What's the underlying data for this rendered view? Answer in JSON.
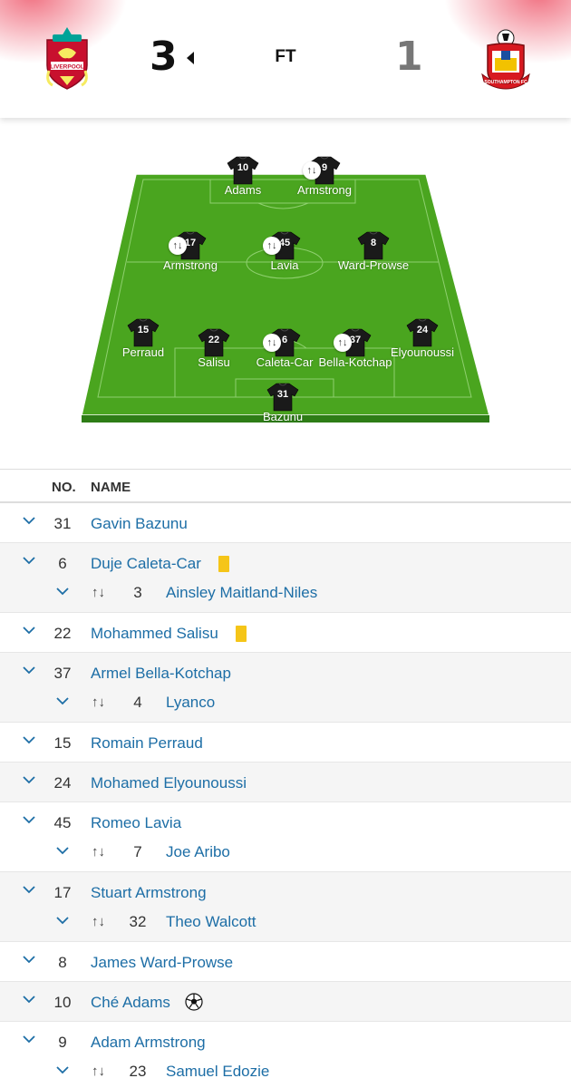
{
  "match": {
    "home_score": "3",
    "away_score": "1",
    "status": "FT",
    "home_crest": "liverpool-crest",
    "away_crest": "southampton-crest",
    "home_crest_text": "LIVERPOOL",
    "away_crest_text": "SOUTHAMPTON FC"
  },
  "colors": {
    "pitch": "#4aa51f",
    "pitch_edge": "#2e7d16",
    "link": "#1d6ea6",
    "yellow_card": "#f5c518",
    "shirt": "#1a1a1a"
  },
  "pitch": {
    "players": [
      {
        "num": "10",
        "name": "Adams",
        "sub": false
      },
      {
        "num": "9",
        "name": "Armstrong",
        "sub": true
      },
      {
        "num": "17",
        "name": "Armstrong",
        "sub": true
      },
      {
        "num": "45",
        "name": "Lavia",
        "sub": true
      },
      {
        "num": "8",
        "name": "Ward-Prowse",
        "sub": false
      },
      {
        "num": "15",
        "name": "Perraud",
        "sub": false
      },
      {
        "num": "22",
        "name": "Salisu",
        "sub": false
      },
      {
        "num": "6",
        "name": "Caleta-Car",
        "sub": true
      },
      {
        "num": "37",
        "name": "Bella-Kotchap",
        "sub": true
      },
      {
        "num": "24",
        "name": "Elyounoussi",
        "sub": false
      },
      {
        "num": "31",
        "name": "Bazunu",
        "sub": false
      }
    ]
  },
  "table": {
    "col_no": "NO.",
    "col_name": "NAME",
    "sub_arrows_glyph": "↑↓",
    "rows": [
      {
        "num": "31",
        "name": "Gavin Bazunu"
      },
      {
        "num": "6",
        "name": "Duje Caleta-Car",
        "card": "yellow",
        "sub_num": "3",
        "sub_name": "Ainsley Maitland-Niles"
      },
      {
        "num": "22",
        "name": "Mohammed Salisu",
        "card": "yellow"
      },
      {
        "num": "37",
        "name": "Armel Bella-Kotchap",
        "sub_num": "4",
        "sub_name": "Lyanco"
      },
      {
        "num": "15",
        "name": "Romain Perraud"
      },
      {
        "num": "24",
        "name": "Mohamed Elyounoussi"
      },
      {
        "num": "45",
        "name": "Romeo Lavia",
        "sub_num": "7",
        "sub_name": "Joe Aribo"
      },
      {
        "num": "17",
        "name": "Stuart Armstrong",
        "sub_num": "32",
        "sub_name": "Theo Walcott"
      },
      {
        "num": "8",
        "name": "James Ward-Prowse"
      },
      {
        "num": "10",
        "name": "Ché Adams",
        "goal": true
      },
      {
        "num": "9",
        "name": "Adam Armstrong",
        "sub_num": "23",
        "sub_name": "Samuel Edozie"
      }
    ]
  }
}
